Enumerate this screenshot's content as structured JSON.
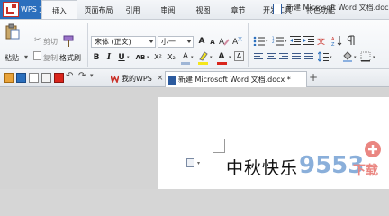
{
  "app": {
    "menu_label": "WPS 文字",
    "document_title": "新建 Microsoft Word 文档.docx"
  },
  "menu_tabs": [
    {
      "label": "插入"
    },
    {
      "label": "页面布局"
    },
    {
      "label": "引用"
    },
    {
      "label": "审阅"
    },
    {
      "label": "视图"
    },
    {
      "label": "章节"
    },
    {
      "label": "开发工具"
    },
    {
      "label": "特色功能"
    }
  ],
  "ribbon": {
    "paste_label": "粘贴",
    "cut_label": "剪切",
    "copy_label": "复制",
    "format_painter_label": "格式刷",
    "font_name": "宋体 (正文)",
    "font_size": "小一",
    "grow_font": "A",
    "shrink_font": "A",
    "bold": "B",
    "italic": "I",
    "underline": "U",
    "strike": "AB",
    "superscript": "X²",
    "subscript": "X₂",
    "font_color_letter": "A",
    "highlight_letter": "A",
    "char_shading_letter": "A"
  },
  "colors": {
    "app_blue": "#2b6fbd",
    "logo_red": "#c93028",
    "highlight_yellow": "#f5e61b",
    "font_red": "#d9251c",
    "word_blue": "#2b5a9e"
  },
  "tabs": {
    "wps_tab_label": "我的WPS",
    "word_tab_label": "新建 Microsoft Word 文档.docx *",
    "close_glyph": "×",
    "add_glyph": "+"
  },
  "document": {
    "text": "中秋快乐"
  },
  "watermark": {
    "text": "9553下载"
  }
}
